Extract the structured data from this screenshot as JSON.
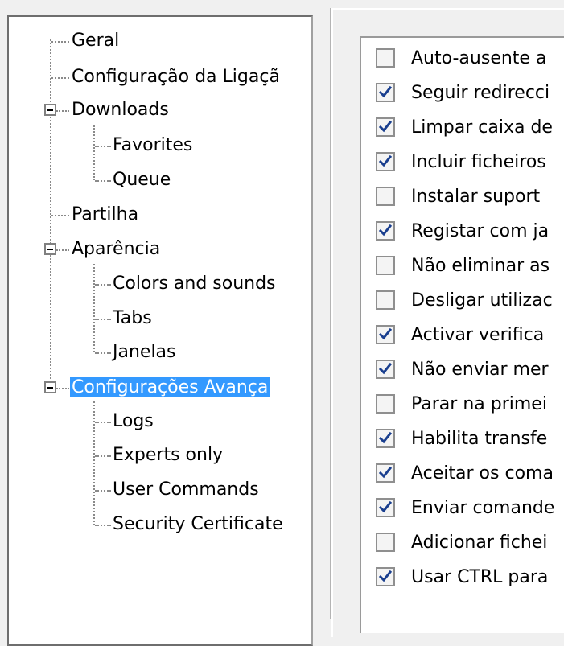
{
  "tree": {
    "items": [
      {
        "label": "Geral",
        "level": 1
      },
      {
        "label": "Configuração da Ligaçã",
        "level": 1
      },
      {
        "label": "Downloads",
        "level": 1,
        "expanded": true
      },
      {
        "label": "Favorites",
        "level": 2
      },
      {
        "label": "Queue",
        "level": 2
      },
      {
        "label": "Partilha",
        "level": 1
      },
      {
        "label": "Aparência",
        "level": 1,
        "expanded": true
      },
      {
        "label": "Colors and sounds",
        "level": 2
      },
      {
        "label": "Tabs",
        "level": 2
      },
      {
        "label": "Janelas",
        "level": 2
      },
      {
        "label": "Configurações Avança",
        "level": 1,
        "expanded": true,
        "selected": true
      },
      {
        "label": "Logs",
        "level": 2
      },
      {
        "label": "Experts only",
        "level": 2
      },
      {
        "label": "User Commands",
        "level": 2
      },
      {
        "label": "Security Certificate",
        "level": 2
      }
    ],
    "selection_color": "#3399ff"
  },
  "options": {
    "items": [
      {
        "label": "Auto-ausente a",
        "checked": false
      },
      {
        "label": "Seguir redirecci",
        "checked": true
      },
      {
        "label": "Limpar caixa de",
        "checked": true
      },
      {
        "label": "Incluir ficheiros",
        "checked": true
      },
      {
        "label": "Instalar suport",
        "checked": false
      },
      {
        "label": "Registar com ja",
        "checked": true
      },
      {
        "label": "Não eliminar as",
        "checked": false
      },
      {
        "label": "Desligar utilizac",
        "checked": false
      },
      {
        "label": "Activar verifica",
        "checked": true
      },
      {
        "label": "Não enviar mer",
        "checked": true
      },
      {
        "label": "Parar na primei",
        "checked": false
      },
      {
        "label": "Habilita transfe",
        "checked": true
      },
      {
        "label": "Aceitar os coma",
        "checked": true
      },
      {
        "label": "Enviar comande",
        "checked": true
      },
      {
        "label": "Adicionar fichei",
        "checked": false
      },
      {
        "label": "Usar CTRL para",
        "checked": true
      }
    ],
    "check_color": "#1a3f8f"
  }
}
